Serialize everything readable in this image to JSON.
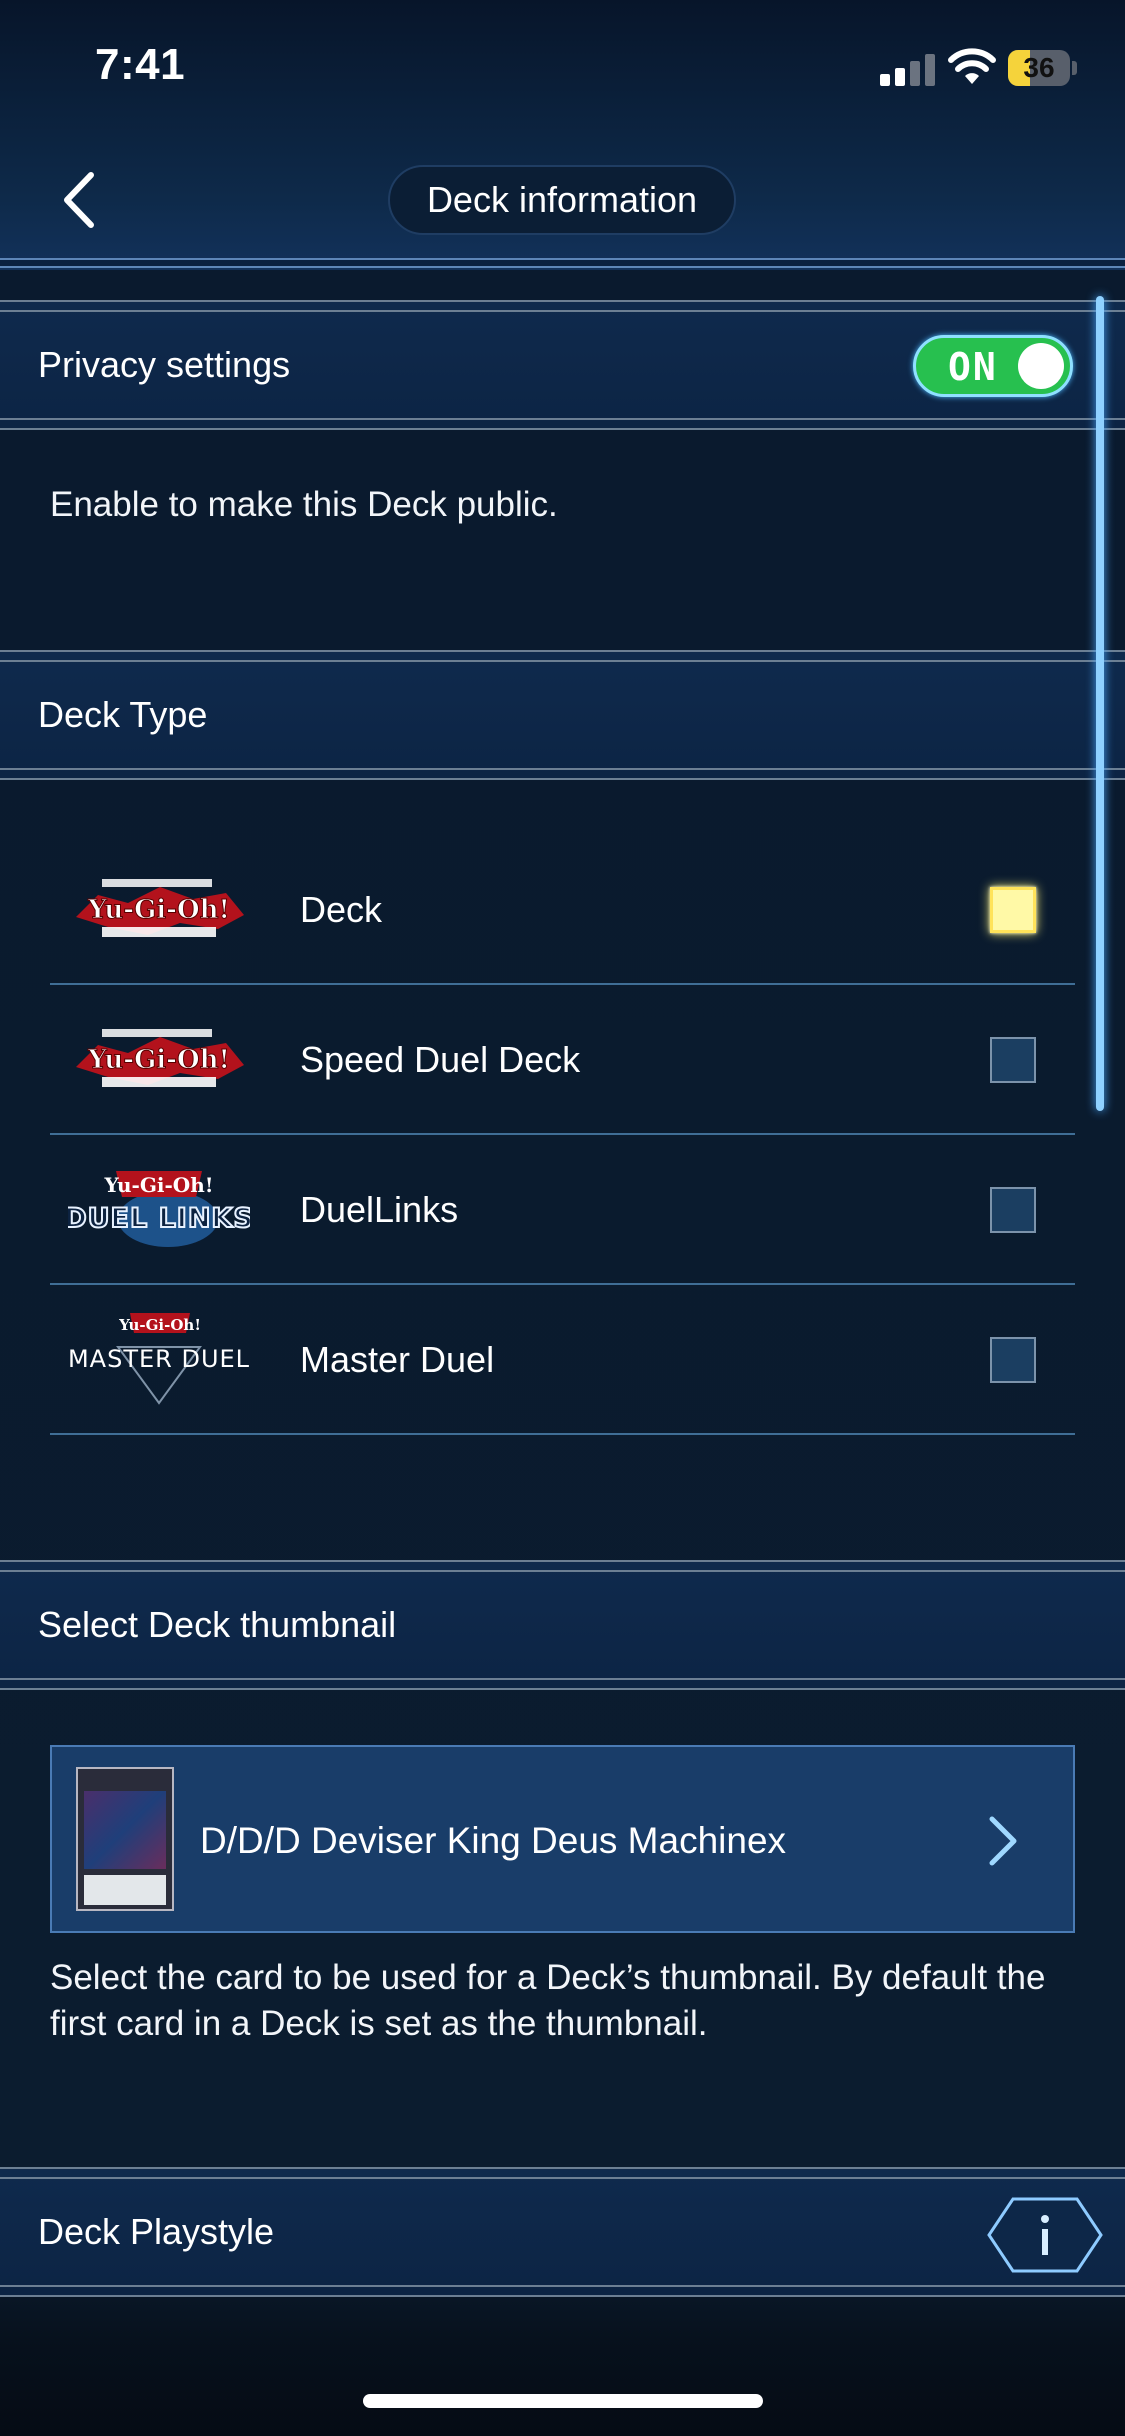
{
  "status_bar": {
    "time": "7:41",
    "battery_level": "36",
    "signal_bars_active": 2,
    "signal_bars_total": 4
  },
  "header": {
    "title": "Deck information",
    "back_icon": "chevron-left-icon"
  },
  "privacy": {
    "title": "Privacy settings",
    "toggle_label": "ON",
    "toggle_on": true,
    "toggle_color": "#27c04f",
    "description": "Enable to make this Deck public."
  },
  "deck_type": {
    "title": "Deck Type",
    "options": [
      {
        "label": "Deck",
        "logo": "yugioh-tcg-logo",
        "checked": true
      },
      {
        "label": "Speed Duel Deck",
        "logo": "yugioh-tcg-logo",
        "checked": false
      },
      {
        "label": "DuelLinks",
        "logo": "duel-links-logo",
        "checked": false
      },
      {
        "label": "Master Duel",
        "logo": "master-duel-logo",
        "checked": false
      }
    ]
  },
  "thumbnail": {
    "title": "Select Deck thumbnail",
    "card_name": "D/D/D Deviser King Deus Machinex",
    "description": "Select the card to be used for a Deck’s thumbnail. By default the first card in a Deck is set as the thumbnail."
  },
  "playstyle": {
    "title": "Deck Playstyle",
    "info_icon": "info-icon"
  },
  "colors": {
    "accent": "#4a7bb5",
    "checked": "#fff9a6",
    "background": "#0a1a2e"
  }
}
